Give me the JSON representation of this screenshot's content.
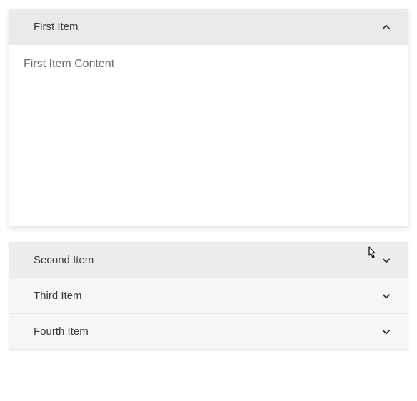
{
  "accordion": {
    "items": [
      {
        "title": "First Item",
        "content": "First Item Content",
        "expanded": true,
        "hovered": false
      },
      {
        "title": "Second Item",
        "expanded": false,
        "hovered": true
      },
      {
        "title": "Third Item",
        "expanded": false,
        "hovered": false
      },
      {
        "title": "Fourth Item",
        "expanded": false,
        "hovered": false
      }
    ]
  }
}
